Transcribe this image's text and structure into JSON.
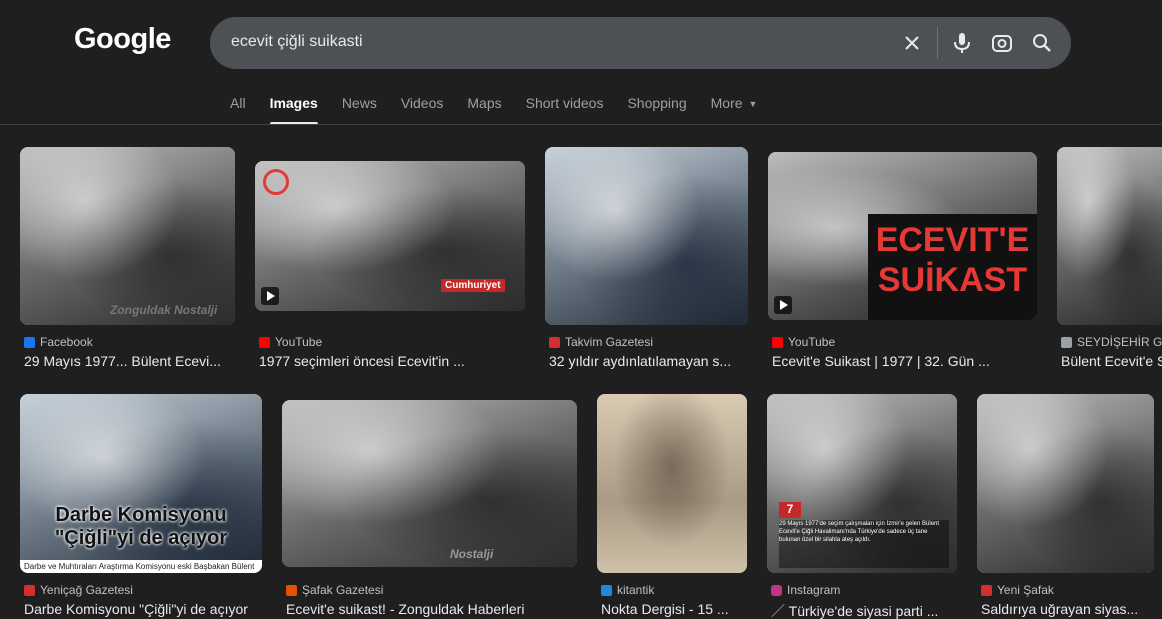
{
  "logo": "Google",
  "search": {
    "query": "ecevit çiğli suikasti"
  },
  "tabs": [
    {
      "label": "All"
    },
    {
      "label": "Images"
    },
    {
      "label": "News"
    },
    {
      "label": "Videos"
    },
    {
      "label": "Maps"
    },
    {
      "label": "Short videos"
    },
    {
      "label": "Shopping"
    },
    {
      "label": "More"
    }
  ],
  "results": [
    {
      "source": "Facebook",
      "title": "29 Mayıs 1977... Bülent Ecevi...",
      "favicon_color": "#1877f2",
      "overlay": "Zonguldak Nostalji"
    },
    {
      "source": "YouTube",
      "title": "1977 seçimleri öncesi Ecevit'in ...",
      "favicon_color": "#ff0000",
      "overlay": "Cumhuriyet"
    },
    {
      "source": "Takvim Gazetesi",
      "title": "32 yıldır aydınlatılamayan s...",
      "favicon_color": "#d32f2f"
    },
    {
      "source": "YouTube",
      "title": "Ecevit'e Suikast | 1977 | 32. Gün ...",
      "favicon_color": "#ff0000",
      "overlay_line1": "ECEVIT'E",
      "overlay_line2": "SUİKAST"
    },
    {
      "source": "SEYDİŞEHİR G",
      "title": "Bülent Ecevit'e S",
      "favicon_color": "#9aa0a6"
    },
    {
      "source": "Yeniçağ Gazetesi",
      "title": "Darbe Komisyonu \"Çiğli\"yi de açıyor",
      "favicon_color": "#d32f2f",
      "overlay_line1": "Darbe Komisyonu",
      "overlay_line2": "\"Çiğli\"yi de açıyor",
      "overlay_caption": "Darbe ve Muhtıraları Araştırma Komisyonu eski Başbakan Bülent"
    },
    {
      "source": "Şafak Gazetesi",
      "title": "Ecevit'e suikast! - Zonguldak Haberleri",
      "favicon_color": "#e65100",
      "overlay": "Nostalji"
    },
    {
      "source": "kitantik",
      "title": "Nokta Dergisi - 15 ...",
      "favicon_color": "#1e88e5"
    },
    {
      "source": "Instagram",
      "title": "Türkiye'de siyasi parti ...",
      "favicon_color": "#c13584",
      "overlay_caption": "29 Mayıs 1977'de seçim çalışmaları için İzmir'e gelen Bülent Ecevit'e Çiğli Havalimanı'nda Türkiye'de sadece üç tane bulunan özel bir silahla ateş açıldı."
    },
    {
      "source": "Yeni Şafak",
      "title": "Saldırıya uğrayan siyas...",
      "favicon_color": "#d32f2f"
    }
  ]
}
